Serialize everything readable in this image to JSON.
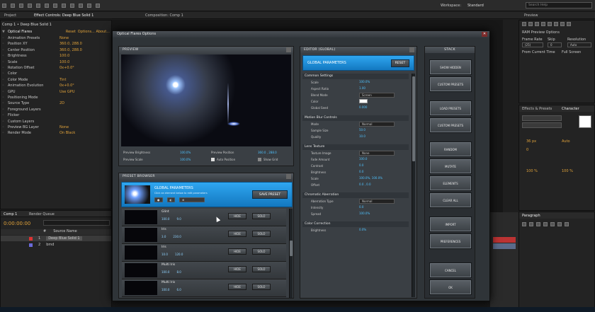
{
  "top_bar": {
    "tabs": [
      "Project",
      "Effect Controls: Deep Blue Solid 1",
      "Composition: Comp 1"
    ],
    "workspace_label": "Workspace:",
    "workspace_value": "Standard",
    "search_placeholder": "Search Help"
  },
  "effect_controls": {
    "layer": "Comp 1 • Deep Blue Solid 1",
    "rows": [
      {
        "label": "Optical Flares",
        "value": "Reset",
        "extra": "Options...  About..."
      },
      {
        "label": "Animation Presets",
        "value": "None"
      },
      {
        "label": "Position XY",
        "value": "360.0, 288.0"
      },
      {
        "label": "Center Position",
        "value": "360.0, 288.0"
      },
      {
        "label": "Brightness",
        "value": "100.0"
      },
      {
        "label": "Scale",
        "value": "100.0"
      },
      {
        "label": "Rotation Offset",
        "value": "0x+0.0°"
      },
      {
        "label": "Color",
        "value": ""
      },
      {
        "label": "Color Mode",
        "value": "Tint"
      },
      {
        "label": "Animation Evolution",
        "value": "0x+0.0°"
      },
      {
        "label": "GPU",
        "value": "Use GPU"
      },
      {
        "label": "Positioning Mode",
        "value": ""
      },
      {
        "label": "Source Type",
        "value": "2D"
      },
      {
        "label": "Foreground Layers",
        "value": ""
      },
      {
        "label": "Flicker",
        "value": ""
      },
      {
        "label": "Custom Layers",
        "value": ""
      },
      {
        "label": "Preview BG Layer",
        "value": "None"
      },
      {
        "label": "Render Mode",
        "value": "On Black"
      }
    ]
  },
  "timeline": {
    "tabs": [
      "Comp 1",
      "Render Queue"
    ],
    "timecode": "0:00:00:00",
    "columns": [
      "#",
      "Source Name"
    ],
    "layers": [
      {
        "num": "1",
        "name": "Deep Blue Solid 1"
      },
      {
        "num": "2",
        "name": "bmd"
      }
    ]
  },
  "right_panels": {
    "preview_tab": "Preview",
    "preview_options": "RAM Preview Options",
    "frame_rate_label": "Frame Rate",
    "skip_label": "Skip",
    "resolution_label": "Resolution",
    "frame_rate": "(25)",
    "skip": "0",
    "resolution": "Auto",
    "from_current": "From Current Time",
    "full_screen": "Full Screen",
    "effects_tab": "Effects & Presets",
    "character_tab": "Character",
    "paragraph_tab": "Paragraph",
    "char_font_size": "36 px",
    "char_leading": "Auto",
    "char_tracking": "0",
    "char_scale": "100 %"
  },
  "dialog": {
    "title": "Optical Flares Options",
    "preview": {
      "header": "PREVIEW",
      "brightness_label": "Preview Brightness",
      "brightness_value": "100.0%",
      "scale_label": "Preview Scale",
      "scale_value": "100.0%",
      "position_label": "Preview Position",
      "position_value": "360.0 , 288.0",
      "auto_position": "Auto Position",
      "show_grid": "Show Grid"
    },
    "preset_browser": {
      "header": "PRESET BROWSER",
      "selected_title": "GLOBAL PARAMETERS",
      "selected_sub": "Click an element below to edit parameters",
      "save_preset": "SAVE PRESET",
      "presets": [
        {
          "name": "Glint",
          "count": "100.0",
          "size": "9.0"
        },
        {
          "name": "Iris",
          "count": "3.0",
          "size": "230.0"
        },
        {
          "name": "Iris",
          "count": "10.0",
          "size": "120.0"
        },
        {
          "name": "Multi Iris",
          "count": "100.0",
          "size": "8.0"
        },
        {
          "name": "Multi Iris",
          "count": "100.0",
          "size": "6.0"
        }
      ],
      "hide_label": "HIDE",
      "solo_label": "SOLO"
    },
    "editor": {
      "header": "EDITOR (GLOBAL)",
      "banner": "GLOBAL PARAMETERS",
      "reset": "RESET",
      "groups": [
        {
          "title": "Common Settings",
          "fields": [
            {
              "label": "Scale",
              "value": "100.0%"
            },
            {
              "label": "Aspect Ratio",
              "value": "1.00"
            },
            {
              "label": "Blend Mode",
              "value": "Screen"
            },
            {
              "label": "Color",
              "value": ""
            },
            {
              "label": "Global Seed",
              "value": "0.000"
            }
          ]
        },
        {
          "title": "Motion Blur Controls",
          "fields": [
            {
              "label": "Mode",
              "value": "Normal"
            },
            {
              "label": "Sample Size",
              "value": "50.0"
            },
            {
              "label": "Quality",
              "value": "10.0"
            }
          ]
        },
        {
          "title": "Lens Texture",
          "fields": [
            {
              "label": "Texture Image",
              "value": "None"
            },
            {
              "label": "Fade Amount",
              "value": "100.0"
            },
            {
              "label": "Contrast",
              "value": "0.0"
            },
            {
              "label": "Brightness",
              "value": "0.0"
            },
            {
              "label": "Scale",
              "value": "100.0%, 100.0%"
            },
            {
              "label": "Offset",
              "value": "0.0 , 0.0"
            }
          ]
        },
        {
          "title": "Chromatic Aberration",
          "fields": [
            {
              "label": "Aberration Type",
              "value": "Normal"
            },
            {
              "label": "Intensity",
              "value": "0.0"
            },
            {
              "label": "Spread",
              "value": "100.0%"
            }
          ]
        },
        {
          "title": "Color Correction",
          "fields": [
            {
              "label": "Brightness",
              "value": "0.0%"
            }
          ]
        }
      ]
    },
    "side_buttons": {
      "header": "STACK",
      "top_group": [
        "SHOW HIDDEN",
        "CUSTOM PRESETS"
      ],
      "load_group": [
        "LOAD PRESETS",
        "CUSTOM PRESETS"
      ],
      "element_group": [
        "RANDOM",
        "MUTATE",
        "ELEMENTS",
        "CLEAR ALL"
      ],
      "file_group": [
        "IMPORT",
        "PREFERENCES"
      ],
      "confirm_group": [
        "CANCEL",
        "OK"
      ]
    }
  }
}
